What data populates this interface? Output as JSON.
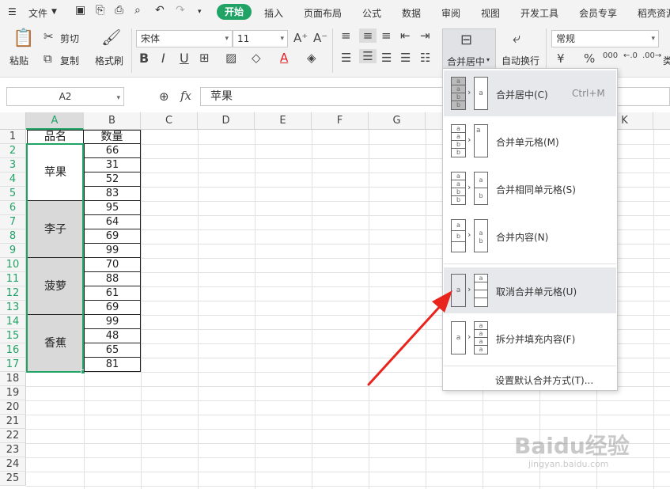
{
  "menubar": {
    "file": "文件",
    "tabs": [
      "开始",
      "插入",
      "页面布局",
      "公式",
      "数据",
      "审阅",
      "视图",
      "开发工具",
      "会员专享",
      "稻壳资源"
    ],
    "active_tab": "开始",
    "active_color": "#21a366"
  },
  "ribbon": {
    "paste": "粘贴",
    "cut": "剪切",
    "copy": "复制",
    "format_painter": "格式刷",
    "font_name": "宋体",
    "font_size": "11",
    "bold": "B",
    "italic": "I",
    "underline": "U",
    "merge_center": "合并居中",
    "wrap_text": "自动换行",
    "number_format": "常规",
    "currency": "¥",
    "percent": "%",
    "thousands": "000",
    "type_partial": "类"
  },
  "formula_bar": {
    "name_box": "A2",
    "fx": "fx",
    "content": "苹果"
  },
  "columns": [
    "A",
    "B",
    "C",
    "D",
    "E",
    "F",
    "G",
    "H",
    "I",
    "J",
    "K"
  ],
  "rows": [
    "1",
    "2",
    "3",
    "4",
    "5",
    "6",
    "7",
    "8",
    "9",
    "10",
    "11",
    "12",
    "13",
    "14",
    "15",
    "16",
    "17",
    "18",
    "19",
    "20",
    "21",
    "22",
    "23",
    "24",
    "25"
  ],
  "sheet": {
    "header_a": "品名",
    "header_b": "数量",
    "merged": [
      "苹果",
      "李子",
      "菠萝",
      "香蕉"
    ],
    "quantities": [
      "66",
      "31",
      "52",
      "83",
      "95",
      "64",
      "69",
      "99",
      "70",
      "88",
      "61",
      "69",
      "99",
      "48",
      "65",
      "81"
    ]
  },
  "merge_menu": {
    "items": [
      {
        "label": "合并居中(C)",
        "shortcut": "Ctrl+M"
      },
      {
        "label": "合并单元格(M)",
        "shortcut": ""
      },
      {
        "label": "合并相同单元格(S)",
        "shortcut": ""
      },
      {
        "label": "合并内容(N)",
        "shortcut": ""
      },
      {
        "label": "取消合并单元格(U)",
        "shortcut": ""
      },
      {
        "label": "拆分并填充内容(F)",
        "shortcut": ""
      }
    ],
    "footer": "设置默认合并方式(T)..."
  },
  "watermark": {
    "text": "Baidu经验",
    "sub": "jingyan.baidu.com"
  }
}
